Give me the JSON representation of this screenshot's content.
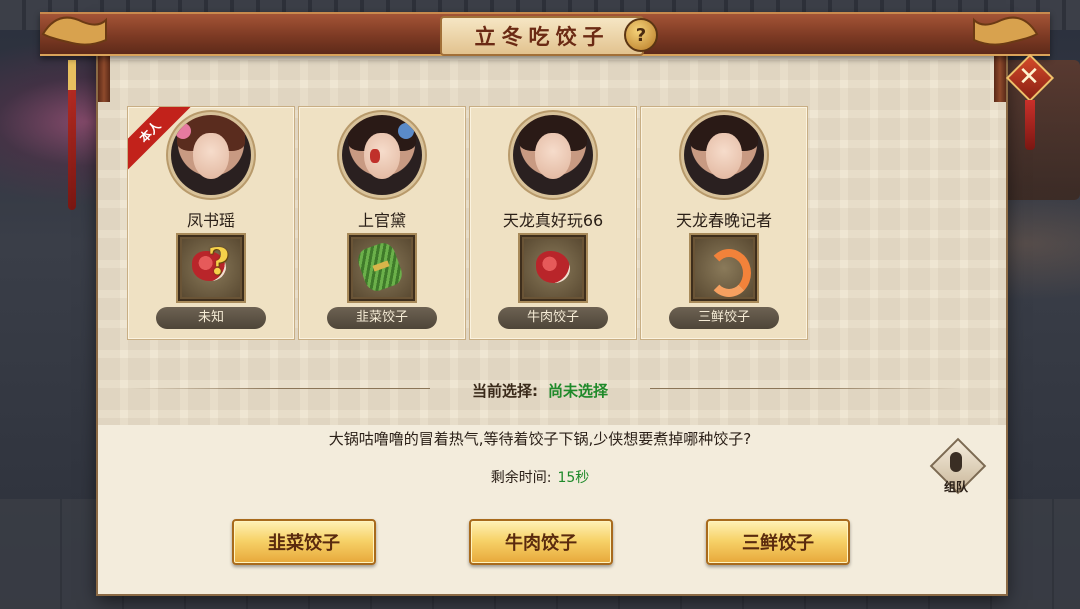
{
  "title": "立冬吃饺子",
  "help_symbol": "?",
  "close_symbol": "✕",
  "self_badge": "本人",
  "players": [
    {
      "name": "凤书瑶",
      "item_label": "未知",
      "item_icon": "unknown-meat-icon"
    },
    {
      "name": "上官黛",
      "item_label": "韭菜饺子",
      "item_icon": "chives-icon"
    },
    {
      "name": "天龙真好玩66",
      "item_label": "牛肉饺子",
      "item_icon": "beef-icon"
    },
    {
      "name": "天龙春晚记者",
      "item_label": "三鲜饺子",
      "item_icon": "shrimp-icon"
    }
  ],
  "selection": {
    "label": "当前选择:",
    "value": "尚未选择"
  },
  "prompt": "大锅咕噜噜的冒着热气,等待着饺子下锅,少侠想要煮掉哪种饺子?",
  "timer": {
    "label": "剩余时间:",
    "value": "15秒"
  },
  "team_button": {
    "label": "组队",
    "icon": "microphone-icon"
  },
  "choices": [
    "韭菜饺子",
    "牛肉饺子",
    "三鲜饺子"
  ],
  "colors": {
    "accent_green": "#1f8a2a",
    "title_brown": "#6b2a14",
    "button_gold": "#f7d36a",
    "badge_red": "#c2221b"
  }
}
